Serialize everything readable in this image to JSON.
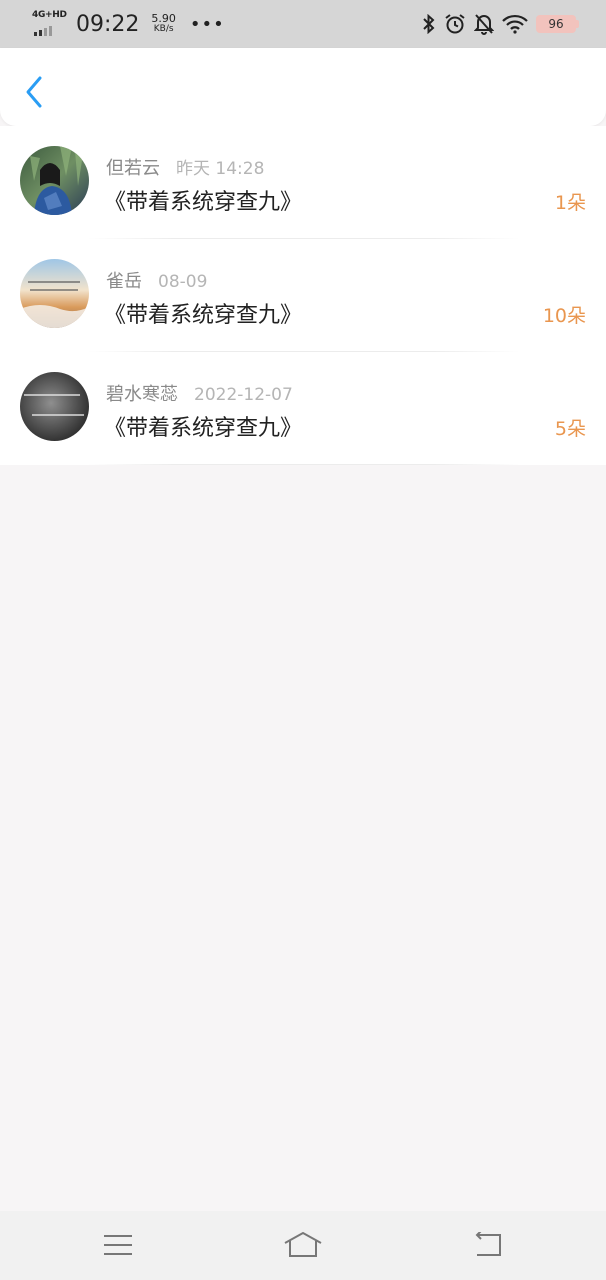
{
  "status_bar": {
    "network": "4G+HD",
    "time": "09:22",
    "speed_value": "5.90",
    "speed_unit": "KB/s",
    "more": "•••",
    "battery": "96",
    "icons": [
      "signal-icon",
      "bluetooth-icon",
      "alarm-icon",
      "mute-bell-icon",
      "wifi-icon",
      "battery-icon"
    ]
  },
  "header": {
    "back_icon": "chevron-left-icon",
    "accent_color": "#2a9df4"
  },
  "list": {
    "items": [
      {
        "name": "但若云",
        "date": "昨天 14:28",
        "book": "《带着系统穿查九》",
        "count": "1朵"
      },
      {
        "name": "雀岳",
        "date": "08-09",
        "book": "《带着系统穿查九》",
        "count": "10朵"
      },
      {
        "name": "碧水寒蕊",
        "date": "2022-12-07",
        "book": "《带着系统穿查九》",
        "count": "5朵"
      }
    ]
  },
  "colors": {
    "count": "#e9964f",
    "name": "#8a8a8a",
    "date": "#b5b5b5",
    "page_bg": "#f7f5f6"
  },
  "navbar": {
    "icons": [
      "menu-icon",
      "home-icon",
      "back-arrow-icon"
    ]
  }
}
